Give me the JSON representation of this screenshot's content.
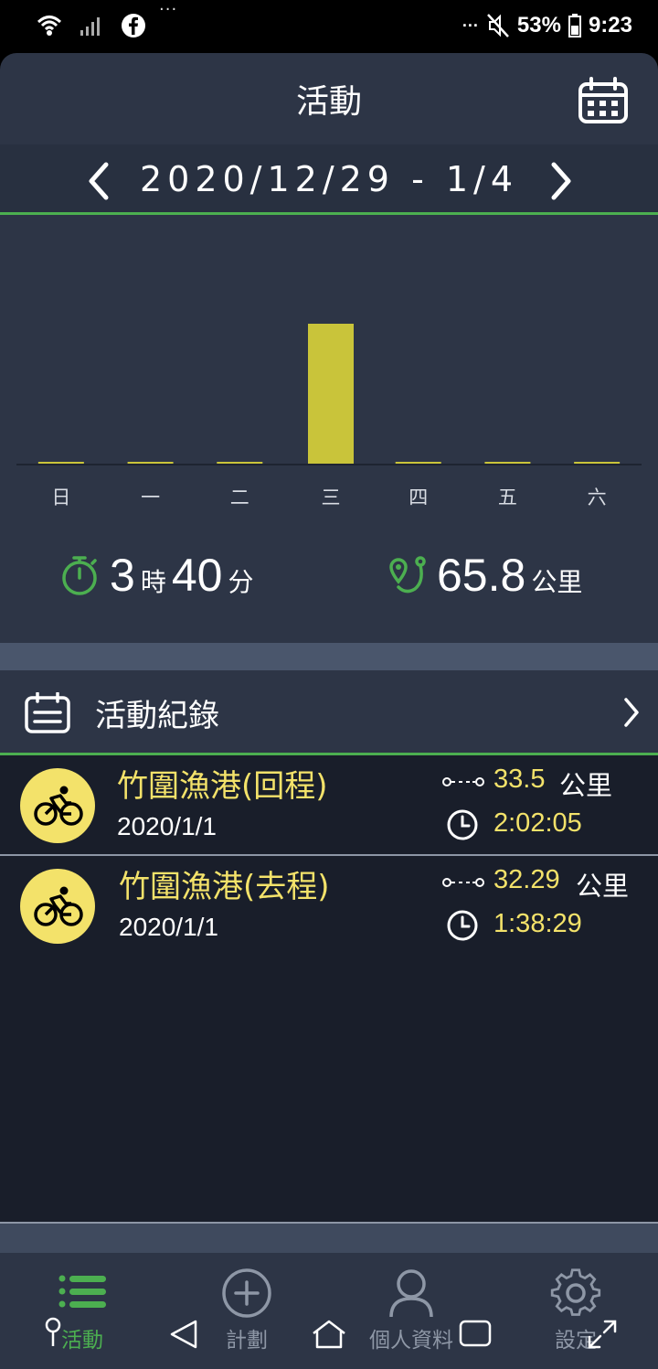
{
  "status_bar": {
    "battery": "53%",
    "time": "9:23",
    "top_dots": "···",
    "right_dots": "···"
  },
  "header": {
    "title": "活動"
  },
  "date_range": "2020/12/29 - 1/4",
  "chart_data": {
    "type": "bar",
    "categories": [
      "日",
      "一",
      "二",
      "三",
      "四",
      "五",
      "六"
    ],
    "values": [
      0,
      0,
      0,
      65.8,
      0,
      0,
      0
    ],
    "bar_color": "#c9c43a"
  },
  "summary": {
    "hours": "3",
    "hours_unit": "時",
    "minutes": "40",
    "minutes_unit": "分",
    "distance": "65.8",
    "distance_unit": "公里"
  },
  "records": {
    "title": "活動紀錄",
    "items": [
      {
        "name": "竹圍漁港(回程)",
        "date": "2020/1/1",
        "distance": "33.5",
        "distance_unit": "公里",
        "duration": "2:02:05",
        "icon": "bicycle-icon"
      },
      {
        "name": "竹圍漁港(去程)",
        "date": "2020/1/1",
        "distance": "32.29",
        "distance_unit": "公里",
        "duration": "1:38:29",
        "icon": "bicycle-icon"
      }
    ]
  },
  "tabs": [
    {
      "label": "活動",
      "icon": "list-icon",
      "active": true
    },
    {
      "label": "計劃",
      "icon": "plus-circle-icon",
      "active": false
    },
    {
      "label": "個人資料",
      "icon": "person-icon",
      "active": false
    },
    {
      "label": "設定",
      "icon": "gear-icon",
      "active": false
    }
  ],
  "colors": {
    "accent_green": "#4caf50",
    "yellow": "#f3e26a",
    "panel": "#2d3546",
    "list_bg": "#191e2a"
  }
}
